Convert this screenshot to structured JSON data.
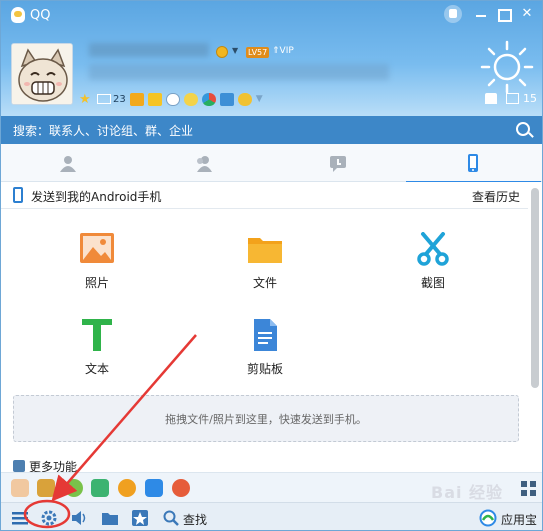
{
  "window": {
    "title": "QQ"
  },
  "profile": {
    "level_badge": "LV57",
    "vip_badge": "VIP",
    "mail_count": "23",
    "message_count": "15"
  },
  "search": {
    "placeholder": "搜索：联系人、讨论组、群、企业"
  },
  "tabs": [
    {
      "icon": "contacts-icon"
    },
    {
      "icon": "friends-group-icon"
    },
    {
      "icon": "recent-chat-icon"
    },
    {
      "icon": "phone-icon",
      "active": true
    }
  ],
  "device": {
    "label": "发送到我的Android手机",
    "history": "查看历史"
  },
  "tiles": [
    {
      "label": "照片",
      "icon": "photo-icon"
    },
    {
      "label": "文件",
      "icon": "folder-icon"
    },
    {
      "label": "截图",
      "icon": "scissors-icon"
    },
    {
      "label": "文本",
      "icon": "text-icon"
    },
    {
      "label": "剪贴板",
      "icon": "clipboard-icon"
    }
  ],
  "dropzone": {
    "text": "拖拽文件/照片到这里，快速发送到手机。"
  },
  "more": {
    "label": "更多功能"
  },
  "bottom": {
    "find_label": "查找",
    "appstore_label": "应用宝"
  },
  "watermark": "Bai 经验",
  "colors": {
    "accent": "#2e8ae6",
    "header": "#5ba6e2",
    "search_bar": "#3d87c8",
    "annotation": "#e53935"
  }
}
